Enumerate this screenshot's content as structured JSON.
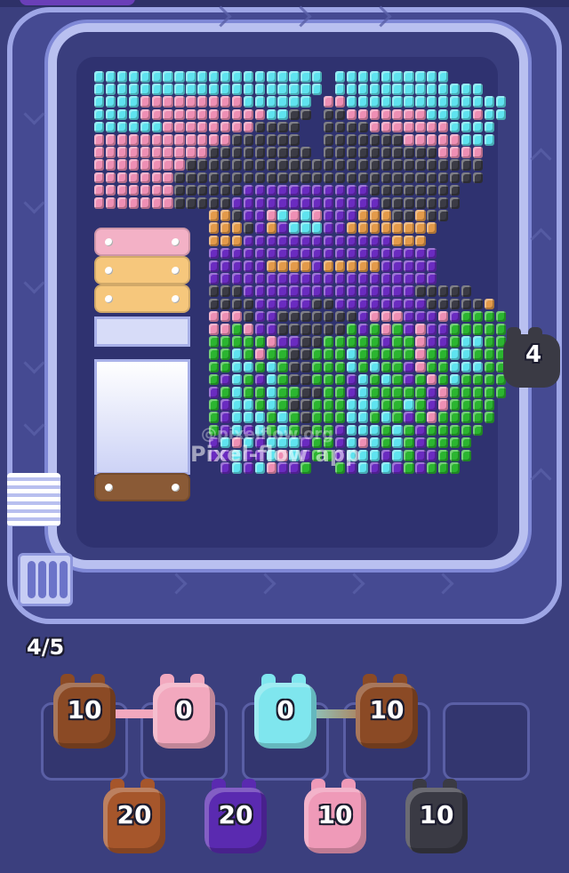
{
  "track_pig": {
    "count": "4",
    "color": "#3a3a44"
  },
  "progress": "4/5",
  "queue_slots": 5,
  "queue_pigs": [
    {
      "count": "10",
      "color": "#8b4a25"
    },
    {
      "count": "0",
      "color": "#f2a8be"
    },
    {
      "count": "0",
      "color": "#7fe6ee"
    },
    {
      "count": "10",
      "color": "#8b4a25"
    }
  ],
  "reserve_pigs": [
    {
      "count": "20",
      "color": "#a6562b"
    },
    {
      "count": "20",
      "color": "#5a2ab0"
    },
    {
      "count": "10",
      "color": "#ef9ab8"
    },
    {
      "count": "10",
      "color": "#3a3a44"
    }
  ],
  "watermark": {
    "line1": "Pixel-flow app",
    "line2": "@pixelflow.org"
  },
  "planks": [
    {
      "color": "#f3b1c6"
    },
    {
      "color": "#f6c77c"
    },
    {
      "color": "#f6c77c"
    }
  ],
  "bottom_plank": {
    "color": "#8a5a36"
  },
  "palette": {
    "cyan": "#5fe3ef",
    "pink": "#ee8fb4",
    "dark": "#3b3b45",
    "purple": "#6a2bc0",
    "orange": "#e39a4a",
    "green": "#2bb530"
  }
}
